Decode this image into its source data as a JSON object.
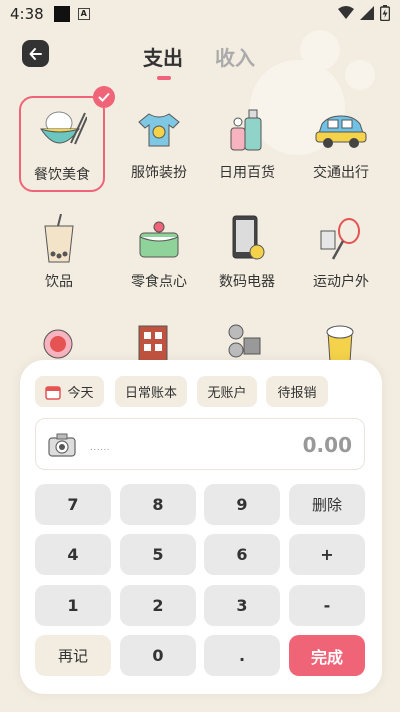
{
  "status_bar": {
    "time": "4:38",
    "a_badge": "A"
  },
  "header": {
    "tab_expense": "支出",
    "tab_income": "收入"
  },
  "categories": [
    {
      "label": "餐饮美食",
      "icon": "food-bowl-icon",
      "selected": true
    },
    {
      "label": "服饰装扮",
      "icon": "tshirt-icon"
    },
    {
      "label": "日用百货",
      "icon": "daily-goods-icon"
    },
    {
      "label": "交通出行",
      "icon": "car-icon"
    },
    {
      "label": "饮品",
      "icon": "bubble-tea-icon"
    },
    {
      "label": "零食点心",
      "icon": "cake-icon"
    },
    {
      "label": "数码电器",
      "icon": "phone-icon"
    },
    {
      "label": "运动户外",
      "icon": "racket-icon"
    }
  ],
  "panel": {
    "chips": {
      "date": "今天",
      "book": "日常账本",
      "account": "无账户",
      "reimburse": "待报销"
    },
    "amount": "0.00",
    "note_placeholder": "......"
  },
  "keypad": {
    "k7": "7",
    "k8": "8",
    "k9": "9",
    "delete": "删除",
    "k4": "4",
    "k5": "5",
    "k6": "6",
    "plus": "+",
    "k1": "1",
    "k2": "2",
    "k3": "3",
    "minus": "-",
    "again": "再记",
    "k0": "0",
    "dot": ".",
    "done": "完成"
  },
  "colors": {
    "accent": "#f06478",
    "background": "#f3ede1"
  }
}
